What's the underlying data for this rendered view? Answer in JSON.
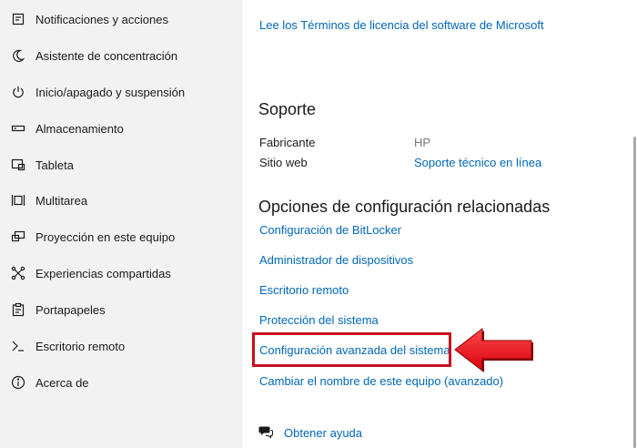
{
  "sidebar": {
    "items": [
      {
        "label": "Notificaciones y acciones",
        "icon": "notifications-icon"
      },
      {
        "label": "Asistente de concentración",
        "icon": "moon-icon"
      },
      {
        "label": "Inicio/apagado y suspensión",
        "icon": "power-icon"
      },
      {
        "label": "Almacenamiento",
        "icon": "storage-icon"
      },
      {
        "label": "Tableta",
        "icon": "tablet-icon"
      },
      {
        "label": "Multitarea",
        "icon": "multitasking-icon"
      },
      {
        "label": "Proyección en este equipo",
        "icon": "projection-icon"
      },
      {
        "label": "Experiencias compartidas",
        "icon": "shared-experiences-icon"
      },
      {
        "label": "Portapapeles",
        "icon": "clipboard-icon"
      },
      {
        "label": "Escritorio remoto",
        "icon": "remote-desktop-icon"
      },
      {
        "label": "Acerca de",
        "icon": "info-icon"
      }
    ]
  },
  "main": {
    "license_link": "Lee los Términos de licencia del software de Microsoft",
    "support": {
      "heading": "Soporte",
      "manufacturer_label": "Fabricante",
      "manufacturer_value": "HP",
      "website_label": "Sitio web",
      "website_value": "Soporte técnico en línea"
    },
    "related": {
      "heading": "Opciones de configuración relacionadas",
      "links": [
        "Configuración de BitLocker",
        "Administrador de dispositivos",
        "Escritorio remoto",
        "Protección del sistema",
        "Configuración avanzada del sistema",
        "Cambiar el nombre de este equipo (avanzado)"
      ]
    },
    "help_link": "Obtener ayuda"
  },
  "colors": {
    "link": "#0067b8",
    "sidebar_bg": "#f2f2f2",
    "highlight": "#c8101e",
    "arrow": "#e8101c"
  }
}
